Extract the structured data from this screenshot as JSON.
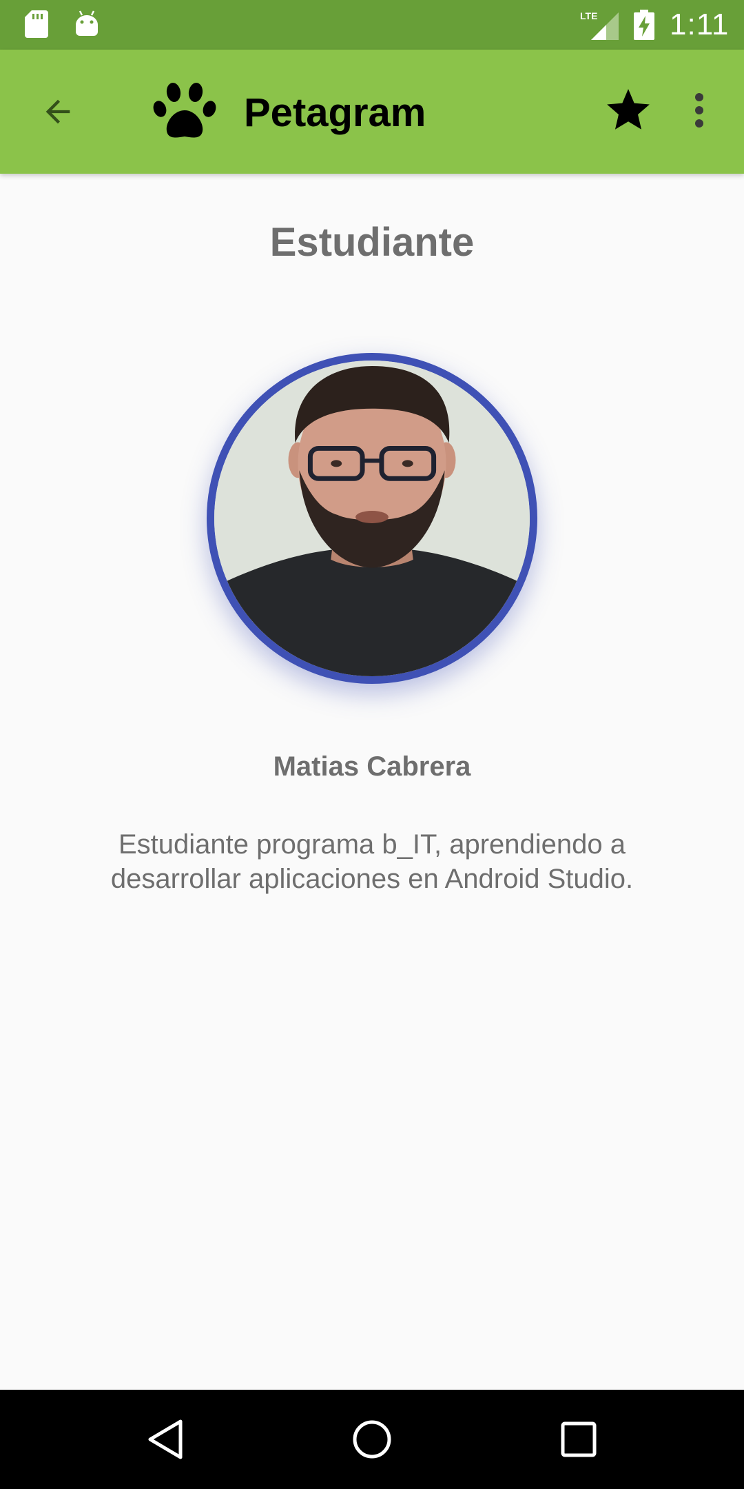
{
  "status_bar": {
    "time": "1:11",
    "network_label": "LTE",
    "icons": [
      "sd-card-icon",
      "android-icon",
      "lte-signal-icon",
      "battery-charging-icon"
    ],
    "background_color": "#689F38"
  },
  "app_bar": {
    "title": "Petagram",
    "back_icon": "arrow-back-icon",
    "logo_icon": "paw-icon",
    "favorite_icon": "star-icon",
    "overflow_icon": "more-vert-icon",
    "background_color": "#8BC34A"
  },
  "profile": {
    "section_title": "Estudiante",
    "name": "Matias Cabrera",
    "bio": "Estudiante programa b_IT, aprendiendo a desarrollar aplicaciones en Android Studio.",
    "avatar_border_color": "#3F51B5"
  },
  "nav_bar": {
    "icons": [
      "nav-back-icon",
      "nav-home-icon",
      "nav-recents-icon"
    ]
  }
}
